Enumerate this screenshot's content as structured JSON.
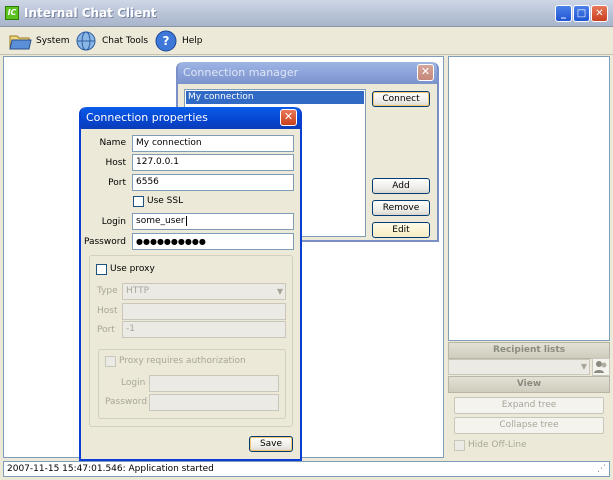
{
  "window": {
    "title": "Internal Chat Client",
    "app_icon_text": "IC",
    "minimize": "_",
    "maximize": "□",
    "close": "✕"
  },
  "menu": [
    {
      "label": "System",
      "icon": "folder-icon"
    },
    {
      "label": "Chat Tools",
      "icon": "globe-icon"
    },
    {
      "label": "Help",
      "icon": "help-icon"
    }
  ],
  "right_panel": {
    "recipient_lists_header": "Recipient lists",
    "view_header": "View",
    "expand_tree": "Expand tree",
    "collapse_tree": "Collapse tree",
    "hide_offline": "Hide Off-Line"
  },
  "status": {
    "message": "2007-11-15 15:47:01.546: Application started"
  },
  "connection_manager": {
    "title": "Connection manager",
    "close": "✕",
    "connections": [
      "My connection"
    ],
    "connect": "Connect",
    "add": "Add",
    "remove": "Remove",
    "edit": "Edit"
  },
  "connection_properties": {
    "title": "Connection properties",
    "close": "✕",
    "name_label": "Name",
    "name_value": "My connection",
    "host_label": "Host",
    "host_value": "127.0.0.1",
    "port_label": "Port",
    "port_value": "6556",
    "ssl_label": "Use SSL",
    "login_label": "Login",
    "login_value": "some_user",
    "password_label": "Password",
    "password_value": "●●●●●●●●●●",
    "proxy": {
      "use_proxy_label": "Use proxy",
      "type_label": "Type",
      "type_value": "HTTP",
      "host_label": "Host",
      "host_value": "",
      "port_label": "Port",
      "port_value": "-1",
      "auth_label": "Proxy requires authorization",
      "login_label": "Login",
      "login_value": "",
      "password_label": "Password",
      "password_value": ""
    },
    "save": "Save"
  }
}
